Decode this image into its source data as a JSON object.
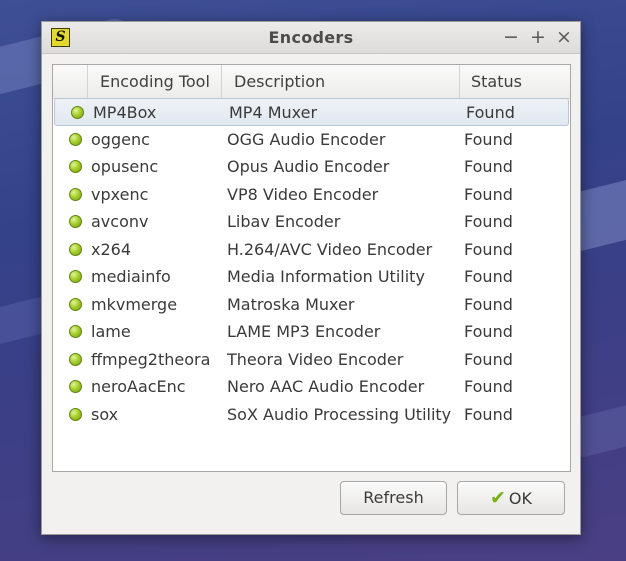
{
  "window": {
    "title": "Encoders",
    "app_icon_glyph": "S",
    "minimize_glyph": "−",
    "maximize_glyph": "+",
    "close_glyph": "×"
  },
  "table": {
    "columns": [
      "",
      "Encoding Tool",
      "Description",
      "Status"
    ],
    "rows": [
      {
        "tool": "MP4Box",
        "description": "MP4 Muxer",
        "status": "Found"
      },
      {
        "tool": "oggenc",
        "description": "OGG Audio Encoder",
        "status": "Found"
      },
      {
        "tool": "opusenc",
        "description": "Opus Audio Encoder",
        "status": "Found"
      },
      {
        "tool": "vpxenc",
        "description": "VP8 Video Encoder",
        "status": "Found"
      },
      {
        "tool": "avconv",
        "description": "Libav Encoder",
        "status": "Found"
      },
      {
        "tool": "x264",
        "description": "H.264/AVC Video Encoder",
        "status": "Found"
      },
      {
        "tool": "mediainfo",
        "description": "Media Information Utility",
        "status": "Found"
      },
      {
        "tool": "mkvmerge",
        "description": "Matroska Muxer",
        "status": "Found"
      },
      {
        "tool": "lame",
        "description": "LAME MP3 Encoder",
        "status": "Found"
      },
      {
        "tool": "ffmpeg2theora",
        "description": "Theora Video Encoder",
        "status": "Found"
      },
      {
        "tool": "neroAacEnc",
        "description": "Nero AAC Audio Encoder",
        "status": "Found"
      },
      {
        "tool": "sox",
        "description": "SoX Audio Processing Utility",
        "status": "Found"
      }
    ],
    "status_indicator_color": "#8fc11f"
  },
  "buttons": {
    "refresh_label": "Refresh",
    "ok_label": "OK",
    "ok_icon": "check-icon"
  }
}
